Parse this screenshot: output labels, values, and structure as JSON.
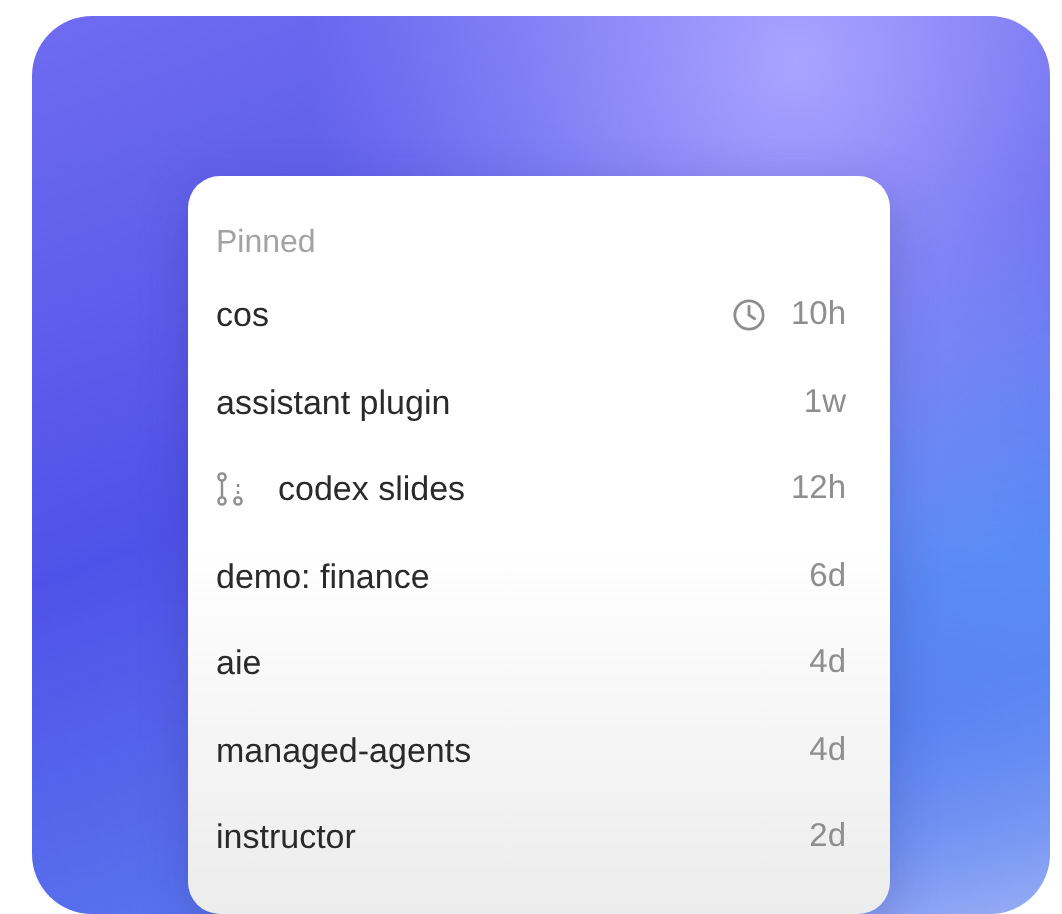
{
  "section_title": "Pinned",
  "items": [
    {
      "kind": "clock",
      "name": "cos",
      "time": "10h"
    },
    {
      "kind": "plain",
      "name": "assistant plugin",
      "time": "1w"
    },
    {
      "kind": "branch",
      "name": "codex slides",
      "time": "12h"
    },
    {
      "kind": "plain",
      "name": "demo: finance",
      "time": "6d"
    },
    {
      "kind": "plain",
      "name": "aie",
      "time": "4d"
    },
    {
      "kind": "plain",
      "name": "managed-agents",
      "time": "4d"
    },
    {
      "kind": "plain",
      "name": "instructor",
      "time": "2d"
    }
  ]
}
